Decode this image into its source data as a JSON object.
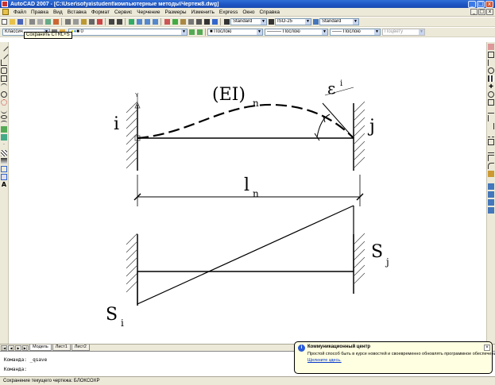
{
  "window": {
    "title": "AutoCAD 2007 - [C:\\User\\sofya\\student\\компьютерные методы\\Чертеж8.dwg]",
    "controls": [
      "_",
      "□",
      "x"
    ]
  },
  "menu": {
    "items": [
      "Файл",
      "Правка",
      "Вид",
      "Вставка",
      "Формат",
      "Сервис",
      "Черчение",
      "Размеры",
      "Изменить",
      "Express",
      "Окно",
      "Справка"
    ],
    "doc_controls": [
      "_",
      "□",
      "x"
    ]
  },
  "toolbar1": {
    "text_style": "Standard",
    "dim_style": "ISO-25",
    "table_style": "Standard"
  },
  "toolbar2": {
    "workspace": "Классич",
    "layer": "0",
    "color": "Послою",
    "linetype": "Послою",
    "lineweight": "Послою",
    "plotstyle": "Поцвету"
  },
  "tooltip": {
    "text": "Сохранить     CTRL+S"
  },
  "drawing": {
    "label_EI": "(EI)",
    "label_n_sub": "n",
    "label_eps": "ε",
    "label_eps_sub": "i",
    "label_i": "i",
    "label_j": "j",
    "label_ln": "l",
    "label_ln_sub": "n",
    "label_Sj": "S",
    "label_Sj_sub": "j",
    "label_Si": "S",
    "label_Si_sub": "i",
    "ucs_y": "Y"
  },
  "tabs": {
    "items": [
      "Модель",
      "Лист1",
      "Лист2"
    ],
    "active": "Модель"
  },
  "command": {
    "line1": "Команда: _qsave",
    "line2": "Команда:"
  },
  "status": {
    "text": "Сохранение текущего чертежа: БЛОКСОХР"
  },
  "balloon": {
    "title": "Коммуникационный центр",
    "text": "Простой способ быть в курсе новостей и своевременно обновлять программное обеспечение.",
    "link": "Щелкните здесь."
  },
  "colors": {
    "titlebar": "#1d54c2",
    "chrome": "#ece9d8",
    "balloon": "#ffffe1"
  }
}
